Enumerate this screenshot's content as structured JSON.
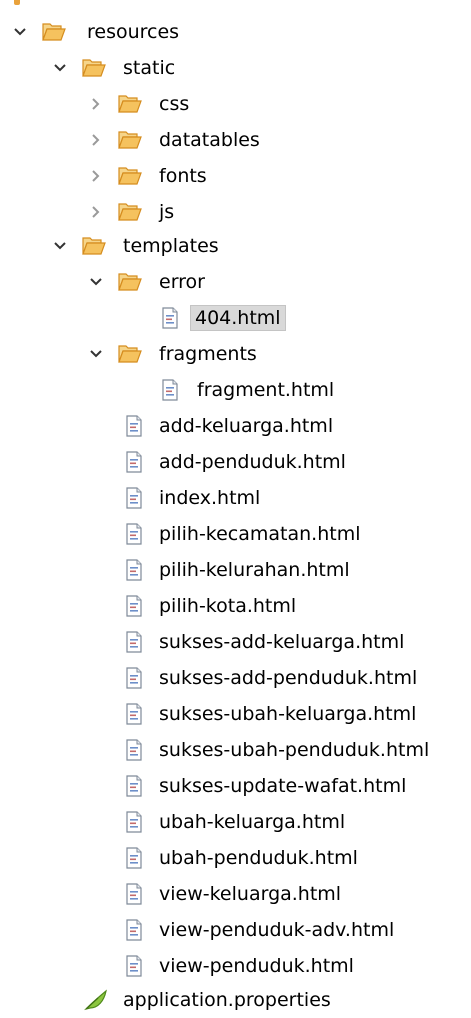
{
  "tree": {
    "resources": {
      "label": "resources",
      "expanded": true
    },
    "static": {
      "label": "static",
      "expanded": true
    },
    "css": {
      "label": "css",
      "expanded": false
    },
    "datatables": {
      "label": "datatables",
      "expanded": false
    },
    "fonts": {
      "label": "fonts",
      "expanded": false
    },
    "js": {
      "label": "js",
      "expanded": false
    },
    "templates": {
      "label": "templates",
      "expanded": true
    },
    "error": {
      "label": "error",
      "expanded": true
    },
    "error_404": {
      "label": "404.html",
      "selected": true
    },
    "fragments": {
      "label": "fragments",
      "expanded": true
    },
    "fragment": {
      "label": "fragment.html"
    },
    "files": [
      "add-keluarga.html",
      "add-penduduk.html",
      "index.html",
      "pilih-kecamatan.html",
      "pilih-kelurahan.html",
      "pilih-kota.html",
      "sukses-add-keluarga.html",
      "sukses-add-penduduk.html",
      "sukses-ubah-keluarga.html",
      "sukses-ubah-penduduk.html",
      "sukses-update-wafat.html",
      "ubah-keluarga.html",
      "ubah-penduduk.html",
      "view-keluarga.html",
      "view-penduduk-adv.html",
      "view-penduduk.html"
    ],
    "properties": {
      "label": "application.properties"
    }
  },
  "icons": {
    "folder": "folder-open-icon",
    "file": "html-file-icon",
    "properties": "properties-leaf-icon",
    "expanded": "chevron-down-icon",
    "collapsed": "chevron-right-icon"
  },
  "colors": {
    "folder": "#e9a23b",
    "chevron_expanded": "#333333",
    "chevron_collapsed": "#9a9a9a",
    "selection": "#d9d9d9",
    "leaf": "#6aa52f"
  }
}
